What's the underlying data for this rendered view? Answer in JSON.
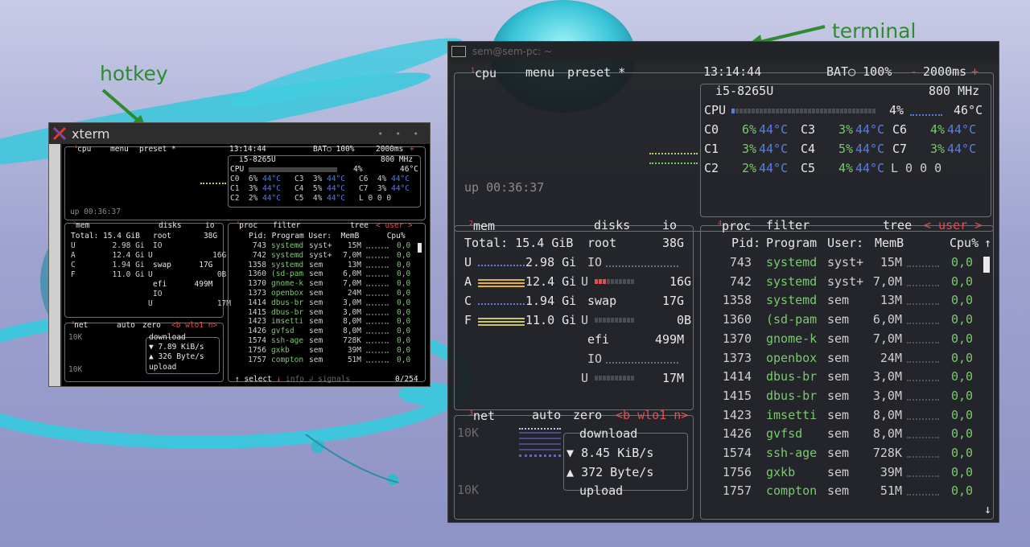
{
  "annotations": {
    "hotkey": "hotkey",
    "terminal": "terminal"
  },
  "xterm": {
    "title": "xterm",
    "controls": "• • •"
  },
  "terminal": {
    "title": "sem@sem-pc: ~"
  },
  "btop": {
    "tabs": {
      "cpu_num": "1",
      "cpu": "cpu",
      "menu": "menu",
      "preset": "preset *"
    },
    "clock": "13:14:44",
    "battery": "BAT○ 100%",
    "interval": "2000ms",
    "minus": "-",
    "plus": "+",
    "cpu_model": "i5-8265U",
    "freq": "800 MHz",
    "cpu_total": {
      "label": "CPU",
      "pct": "4%",
      "temp": "46°C",
      "fill": 0.04
    },
    "cores": [
      {
        "l": "C0",
        "p": "6%",
        "t": "44°C"
      },
      {
        "l": "C1",
        "p": "3%",
        "t": "44°C"
      },
      {
        "l": "C2",
        "p": "2%",
        "t": "44°C"
      },
      {
        "l": "C3",
        "p": "3%",
        "t": "44°C"
      },
      {
        "l": "C4",
        "p": "5%",
        "t": "44°C"
      },
      {
        "l": "C5",
        "p": "4%",
        "t": "44°C"
      },
      {
        "l": "C6",
        "p": "4%",
        "t": "44°C"
      },
      {
        "l": "C7",
        "p": "3%",
        "t": "44°C"
      }
    ],
    "load": "L 0 0 0",
    "uptime": "up 00:36:37",
    "mem": {
      "num": "2",
      "title": "mem",
      "total": "Total: 15.4 GiB",
      "rows": [
        {
          "l": "U",
          "v": "2.98 Gi"
        },
        {
          "l": "A",
          "v": "12.4 Gi"
        },
        {
          "l": "C",
          "v": "1.94 Gi"
        },
        {
          "l": "F",
          "v": "11.0 Gi"
        }
      ]
    },
    "disks": {
      "title": "disks",
      "io": "io",
      "root": {
        "name": "root",
        "size": "38G",
        "io": "IO",
        "u": "U",
        "used": "16G"
      },
      "swap": {
        "name": "swap",
        "size": "17G",
        "u": "U",
        "used": "0B"
      },
      "efi": {
        "name": "efi",
        "size": "499M",
        "io": "IO",
        "u": "U",
        "used": "17M"
      }
    },
    "net": {
      "num": "3",
      "title": "net",
      "auto": "auto",
      "zero": "zero",
      "iface": "<b wlo1 n>",
      "scale_top": "10K",
      "scale_bot": "10K",
      "download": "download",
      "dl_rate": "8.45 KiB/s",
      "ul_rate": "372 Byte/s",
      "upload": "upload",
      "dl_rate_small": "7.89 KiB/s",
      "ul_rate_small": "326 Byte/s"
    },
    "proc": {
      "num": "4",
      "title": "proc",
      "filter": "filter",
      "tree": "tree",
      "user": "< user >",
      "headers": {
        "pid": "Pid:",
        "prog": "Program",
        "user": "User:",
        "mem": "MemB",
        "cpu": "Cpu%"
      },
      "rows": [
        {
          "pid": "743",
          "prog": "systemd",
          "user": "syst+",
          "mem": "15M",
          "cpu": "0,0"
        },
        {
          "pid": "742",
          "prog": "systemd",
          "user": "syst+",
          "mem": "7,0M",
          "cpu": "0,0"
        },
        {
          "pid": "1358",
          "prog": "systemd",
          "user": "sem",
          "mem": "13M",
          "cpu": "0,0"
        },
        {
          "pid": "1360",
          "prog": "(sd-pam",
          "user": "sem",
          "mem": "6,0M",
          "cpu": "0,0"
        },
        {
          "pid": "1370",
          "prog": "gnome-k",
          "user": "sem",
          "mem": "7,0M",
          "cpu": "0,0"
        },
        {
          "pid": "1373",
          "prog": "openbox",
          "user": "sem",
          "mem": "24M",
          "cpu": "0,0"
        },
        {
          "pid": "1414",
          "prog": "dbus-br",
          "user": "sem",
          "mem": "3,0M",
          "cpu": "0,0"
        },
        {
          "pid": "1415",
          "prog": "dbus-br",
          "user": "sem",
          "mem": "3,0M",
          "cpu": "0,0"
        },
        {
          "pid": "1423",
          "prog": "imsetti",
          "user": "sem",
          "mem": "8,0M",
          "cpu": "0,0"
        },
        {
          "pid": "1426",
          "prog": "gvfsd",
          "user": "sem",
          "mem": "8,0M",
          "cpu": "0,0"
        },
        {
          "pid": "1574",
          "prog": "ssh-age",
          "user": "sem",
          "mem": "728K",
          "cpu": "0,0"
        },
        {
          "pid": "1756",
          "prog": "gxkb",
          "user": "sem",
          "mem": "39M",
          "cpu": "0,0"
        },
        {
          "pid": "1757",
          "prog": "compton",
          "user": "sem",
          "mem": "51M",
          "cpu": "0,0"
        }
      ],
      "footer": {
        "up": "↑",
        "select": "select",
        "down": "↓",
        "info": "info",
        "enter": "↲",
        "signals": "signals",
        "count": "0/254"
      }
    }
  },
  "colors": {
    "term_bg": "#1b1c1e",
    "xterm_bg": "#000000",
    "green_text": "#7bc96f",
    "blue_text": "#5b7fe0",
    "accent_red": "#e05050",
    "annotation": "#2e8b2e",
    "wallpaper_cyan": "#4fd0e0"
  }
}
